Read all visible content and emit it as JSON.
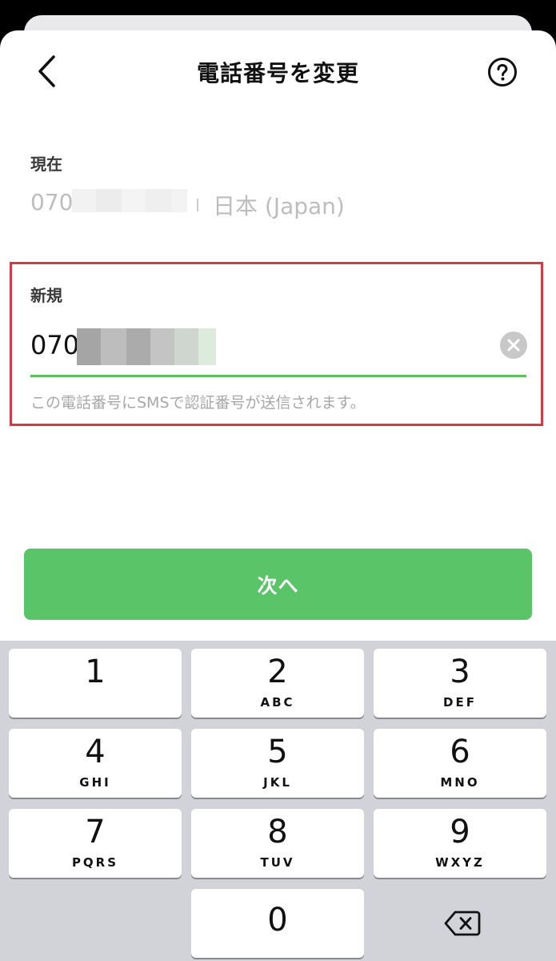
{
  "nav": {
    "title": "電話番号を変更"
  },
  "current": {
    "label": "現在",
    "number_prefix": "070",
    "country": "日本 (Japan)"
  },
  "new": {
    "label": "新規",
    "number_prefix": "070",
    "hint": "この電話番号にSMSで認証番号が送信されます。"
  },
  "actions": {
    "next_label": "次へ"
  },
  "keypad": {
    "keys": [
      {
        "digit": "1",
        "letters": ""
      },
      {
        "digit": "2",
        "letters": "ABC"
      },
      {
        "digit": "3",
        "letters": "DEF"
      },
      {
        "digit": "4",
        "letters": "GHI"
      },
      {
        "digit": "5",
        "letters": "JKL"
      },
      {
        "digit": "6",
        "letters": "MNO"
      },
      {
        "digit": "7",
        "letters": "PQRS"
      },
      {
        "digit": "8",
        "letters": "TUV"
      },
      {
        "digit": "9",
        "letters": "WXYZ"
      },
      {
        "digit": "0",
        "letters": ""
      }
    ]
  },
  "colors": {
    "accent_green": "#5bc25e",
    "button_green": "#5ac468",
    "highlight_red": "#d33a43"
  },
  "icons": {
    "back": "chevron-left-icon",
    "help": "question-circle-icon",
    "clear": "clear-circle-icon",
    "delete": "backspace-icon"
  }
}
